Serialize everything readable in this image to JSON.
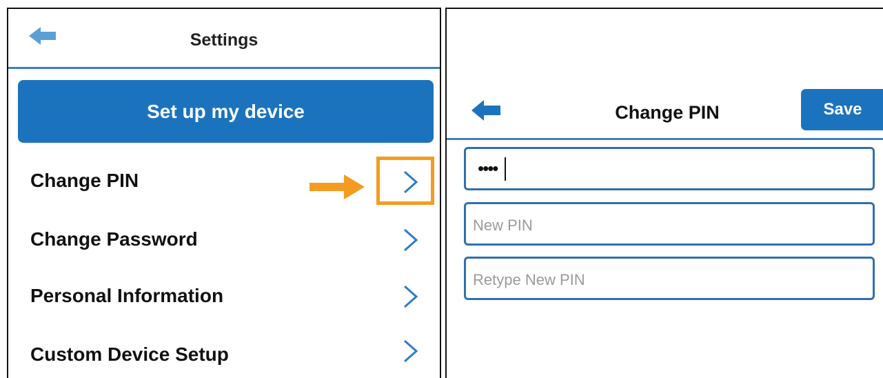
{
  "settings_screen": {
    "title": "Settings",
    "back_icon": "back-arrow-icon",
    "setup_button_label": "Set up my device",
    "menu_items": [
      {
        "label": "Change PIN",
        "icon": "chevron-right-icon"
      },
      {
        "label": "Change Password",
        "icon": "chevron-right-icon"
      },
      {
        "label": "Personal Information",
        "icon": "chevron-right-icon"
      },
      {
        "label": "Custom Device Setup",
        "icon": "chevron-right-icon"
      }
    ],
    "callout_icon": "orange-pointer-arrow-icon"
  },
  "change_pin_screen": {
    "title": "Change PIN",
    "back_icon": "back-arrow-icon",
    "save_label": "Save",
    "fields": {
      "current_pin_value": "••••",
      "new_pin_placeholder": "New PIN",
      "retype_pin_placeholder": "Retype New PIN"
    }
  },
  "colors": {
    "accent": "#1c73bd",
    "back_arrow_light": "#5aa0d6",
    "field_border": "#2f6fb0",
    "highlight": "#f39c21"
  }
}
